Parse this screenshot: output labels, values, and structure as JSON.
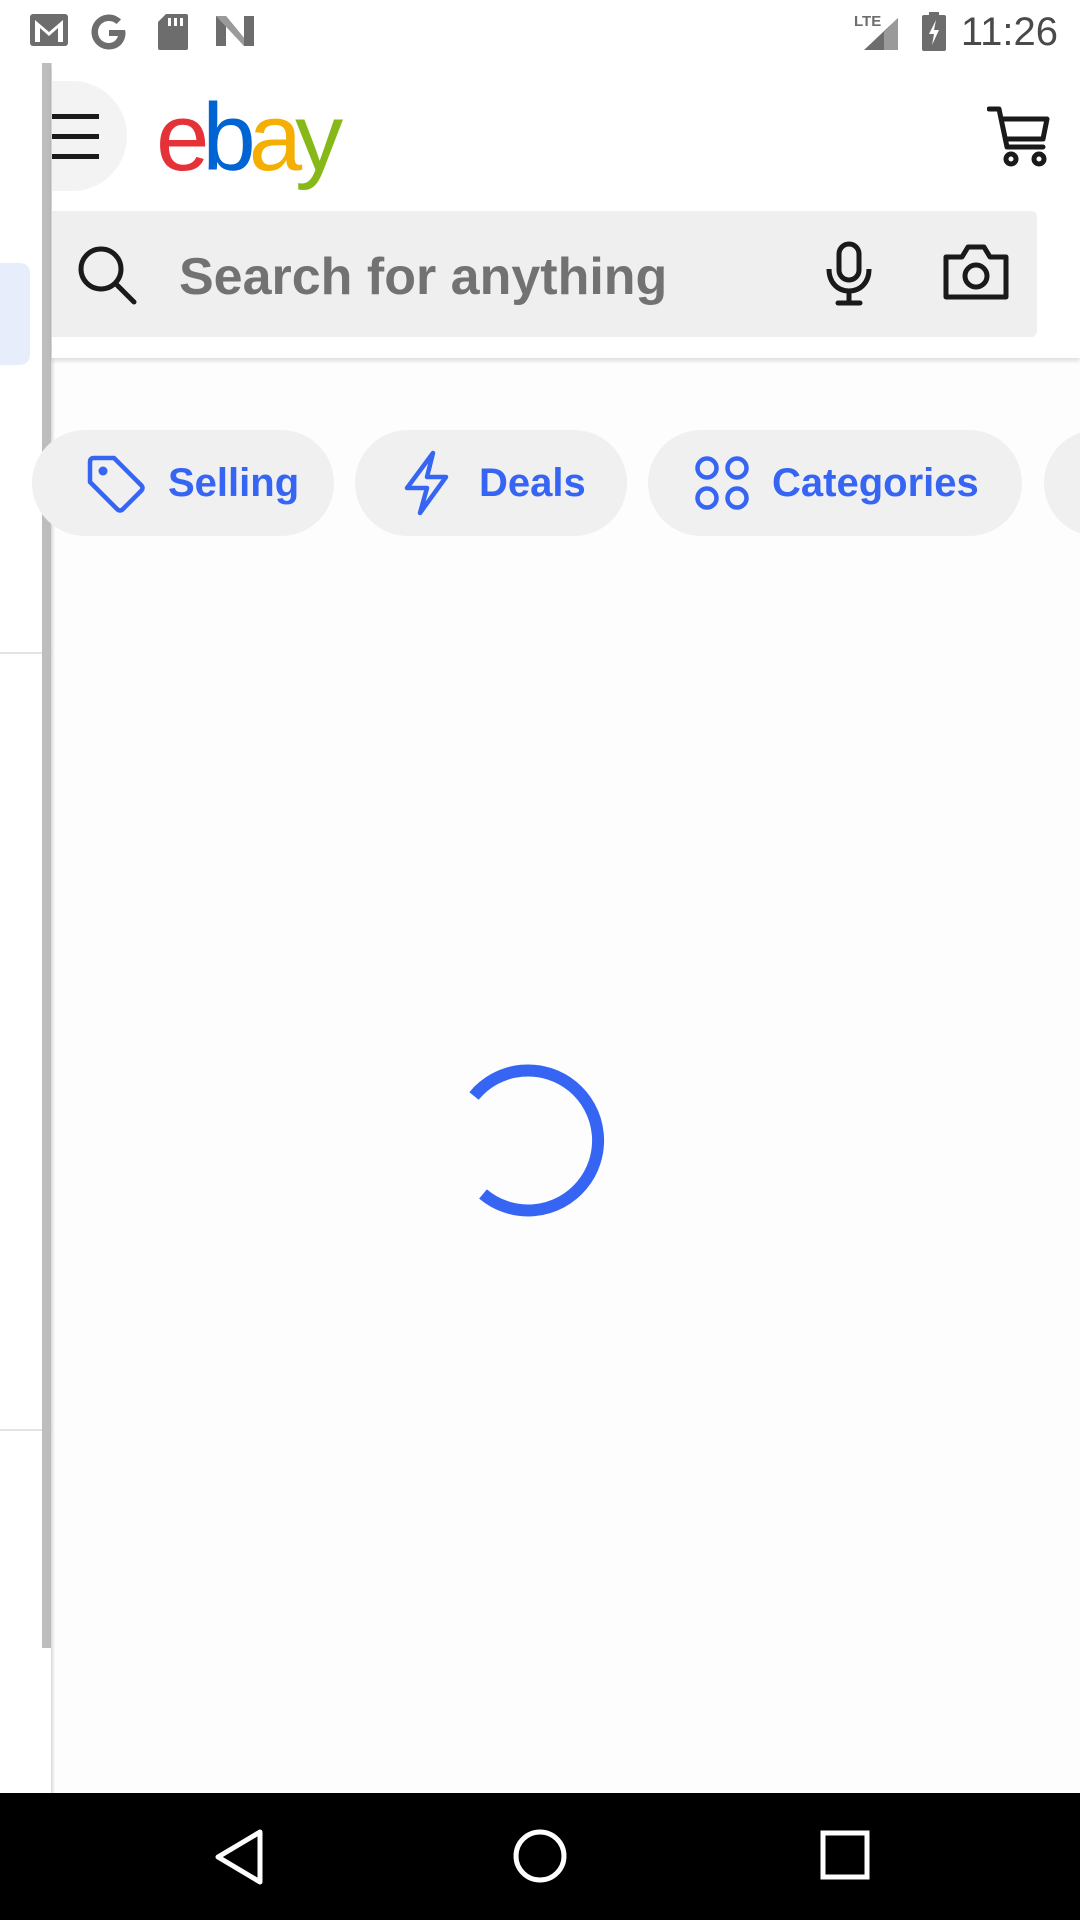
{
  "status_bar": {
    "time": "11:26",
    "network": "LTE",
    "notification_icons": [
      "gmail-icon",
      "google-icon",
      "sd-card-icon",
      "n-app-icon"
    ]
  },
  "header": {
    "logo_letters": [
      "e",
      "b",
      "a",
      "y"
    ],
    "logo_colors": [
      "#e53238",
      "#0064d2",
      "#f5af02",
      "#86b817"
    ]
  },
  "search": {
    "placeholder": "Search for anything"
  },
  "chips": [
    {
      "label": "Selling",
      "icon": "tag-icon"
    },
    {
      "label": "Deals",
      "icon": "lightning-icon"
    },
    {
      "label": "Categories",
      "icon": "grid-circles-icon"
    }
  ],
  "colors": {
    "accent": "#3665f3",
    "chip_background": "#f0f0f0",
    "search_background": "#efefef"
  },
  "loading": {
    "state": "loading",
    "icon": "spinner-icon"
  }
}
